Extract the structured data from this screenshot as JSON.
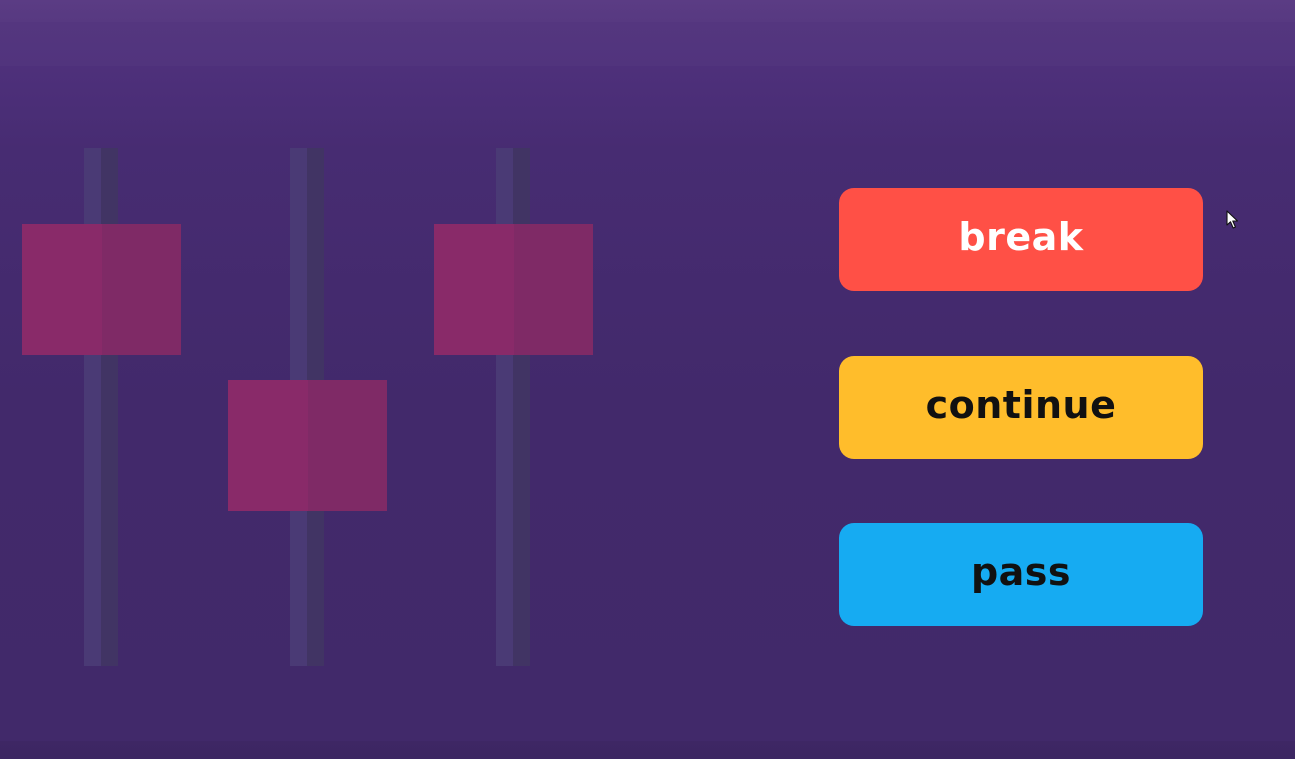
{
  "buttons": {
    "break_label": "break",
    "continue_label": "continue",
    "pass_label": "pass"
  },
  "colors": {
    "background": "#42296b",
    "break": "#ff5046",
    "continue": "#ffbd2b",
    "pass": "#16abf2",
    "slider_knob": "#892a69",
    "slider_track": "#4a3a75"
  },
  "icons": {
    "decoration": "mixer-sliders-icon",
    "pointer": "mouse-cursor-icon"
  }
}
